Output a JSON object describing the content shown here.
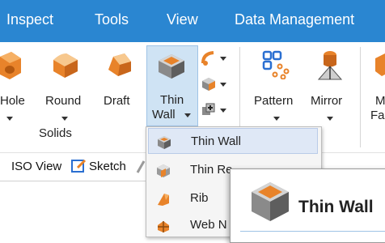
{
  "menubar": {
    "items": [
      "Inspect",
      "Tools",
      "View",
      "Data Management"
    ]
  },
  "ribbon": {
    "hole_label": "Hole",
    "round_label": "Round",
    "draft_label": "Draft",
    "thinwall_label_1": "Thin",
    "thinwall_label_2": "Wall",
    "pattern_label": "Pattern",
    "mirror_label": "Mirror",
    "cut_label_1": "M",
    "cut_label_2": "Fa",
    "group_solids": "Solids"
  },
  "toolbar2": {
    "iso_view": "ISO View",
    "sketch": "Sketch"
  },
  "dropdown": {
    "items": [
      {
        "label": "Thin Wall",
        "icon": "thin-wall-icon",
        "selected": true
      },
      {
        "label": "Thin Re",
        "icon": "thin-region-icon",
        "selected": false
      },
      {
        "label": "Rib",
        "icon": "rib-icon",
        "selected": false
      },
      {
        "label": "Web N",
        "icon": "web-network-icon",
        "selected": false
      }
    ]
  },
  "tooltip": {
    "title": "Thin Wall"
  },
  "colors": {
    "menubar": "#2a86d1",
    "accent_orange": "#e8832a",
    "selection": "#dfe8f6"
  }
}
